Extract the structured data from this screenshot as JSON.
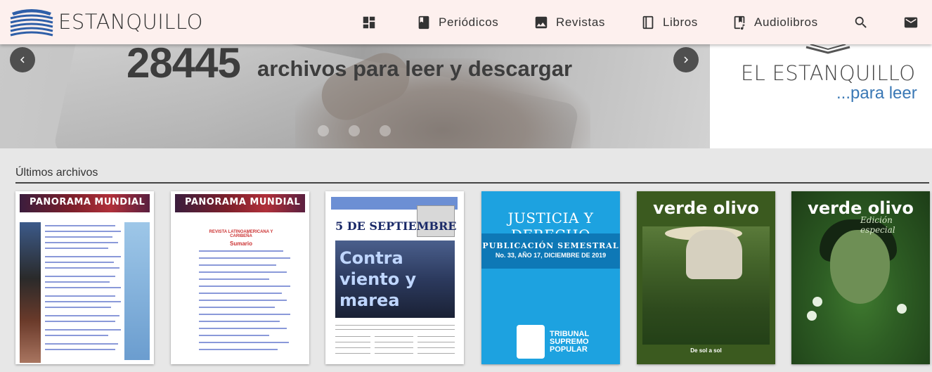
{
  "brand": {
    "name": "ESTANQUILLO",
    "hero_title": "EL ESTANQUILLO",
    "hero_subtitle": "...para leer"
  },
  "nav": {
    "items": [
      {
        "label": "",
        "icon": "dashboard-icon"
      },
      {
        "label": "Periódicos",
        "icon": "bookmark-book-icon"
      },
      {
        "label": "Revistas",
        "icon": "image-icon"
      },
      {
        "label": "Libros",
        "icon": "book-icon"
      },
      {
        "label": "Audiolibros",
        "icon": "audiobook-icon"
      },
      {
        "label": "",
        "icon": "search-icon"
      },
      {
        "label": "",
        "icon": "mail-icon"
      }
    ]
  },
  "hero": {
    "count": "28445",
    "caption": "archivos para leer y descargar",
    "slides": 3,
    "active_slide": 0
  },
  "latest": {
    "title": "Últimos archivos",
    "cards": [
      {
        "cover_title": "PANORAMA MUNDIAL"
      },
      {
        "cover_title": "PANORAMA MUNDIAL",
        "cover_subtitle": "REVISTA LATINOAMERICANA Y CARIBEÑA",
        "cover_heading": "Sumario"
      },
      {
        "cover_title": "5 DE SEPTIEMBRE",
        "cover_headline": "Contra viento y marea"
      },
      {
        "cover_title": "JUSTICIA Y DERECHO",
        "cover_subtitle": "PUBLICACIÓN SEMESTRAL",
        "cover_issue": "No. 33, AÑO 17, DICIEMBRE DE 2019",
        "cover_publisher": "TRIBUNAL SUPREMO POPULAR"
      },
      {
        "cover_title": "verde olivo",
        "cover_caption": "De sol a sol"
      },
      {
        "cover_title": "verde olivo",
        "cover_edition": "Edición especial"
      }
    ]
  },
  "colors": {
    "nav_bg": "#fdf0ee",
    "link_blue": "#3a78b5",
    "page_bg": "#e7e7e7"
  }
}
